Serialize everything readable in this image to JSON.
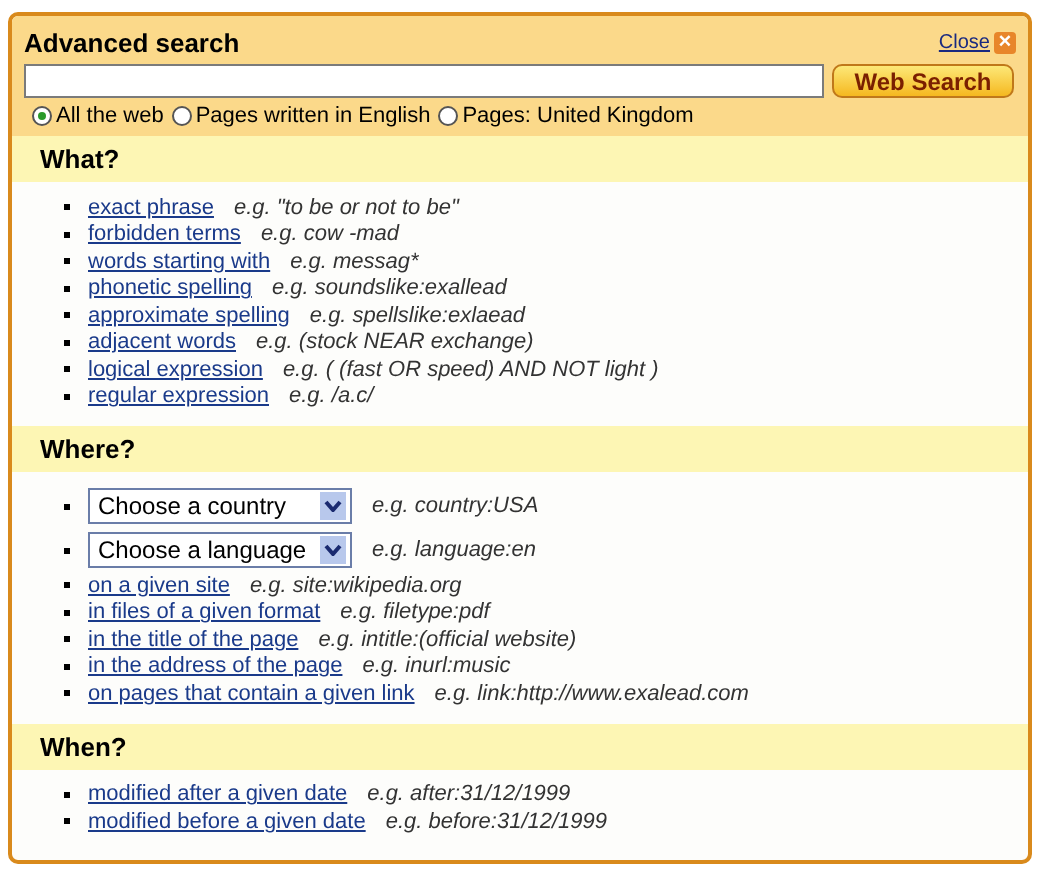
{
  "title": "Advanced search",
  "close": {
    "label": "Close",
    "icon": "×"
  },
  "search": {
    "button": "Web Search"
  },
  "scopes": [
    {
      "label": "All the web",
      "selected": true
    },
    {
      "label": "Pages written in English",
      "selected": false
    },
    {
      "label": "Pages: United Kingdom",
      "selected": false
    }
  ],
  "sections": [
    {
      "heading": "What?",
      "items": [
        {
          "kind": "link",
          "label": "exact phrase",
          "example": "e.g. \"to be or not to be\""
        },
        {
          "kind": "link",
          "label": "forbidden terms",
          "example": "e.g. cow -mad"
        },
        {
          "kind": "link",
          "label": "words starting with",
          "example": "e.g. messag*"
        },
        {
          "kind": "link",
          "label": "phonetic spelling",
          "example": "e.g. soundslike:exallead"
        },
        {
          "kind": "link",
          "label": "approximate spelling",
          "example": "e.g. spellslike:exlaead"
        },
        {
          "kind": "link",
          "label": "adjacent words",
          "example": "e.g. (stock NEAR exchange)"
        },
        {
          "kind": "link",
          "label": "logical expression",
          "example": "e.g. ( (fast OR speed) AND NOT light )"
        },
        {
          "kind": "link",
          "label": "regular expression",
          "example": "e.g. /a.c/"
        }
      ]
    },
    {
      "heading": "Where?",
      "items": [
        {
          "kind": "select",
          "label": "Choose a country",
          "example": "e.g. country:USA"
        },
        {
          "kind": "select",
          "label": "Choose a language",
          "example": "e.g. language:en"
        },
        {
          "kind": "link",
          "label": "on a given site",
          "example": "e.g. site:wikipedia.org"
        },
        {
          "kind": "link",
          "label": "in files of a given format",
          "example": "e.g. filetype:pdf"
        },
        {
          "kind": "link",
          "label": "in the title of the page",
          "example": "e.g. intitle:(official website)"
        },
        {
          "kind": "link",
          "label": "in the address of the page",
          "example": "e.g. inurl:music"
        },
        {
          "kind": "link",
          "label": "on pages that contain a given link",
          "example": "e.g. link:http://www.exalead.com"
        }
      ]
    },
    {
      "heading": "When?",
      "items": [
        {
          "kind": "link",
          "label": "modified after a given date",
          "example": "e.g. after:31/12/1999"
        },
        {
          "kind": "link",
          "label": "modified before a given date",
          "example": "e.g. before:31/12/1999"
        }
      ]
    }
  ]
}
